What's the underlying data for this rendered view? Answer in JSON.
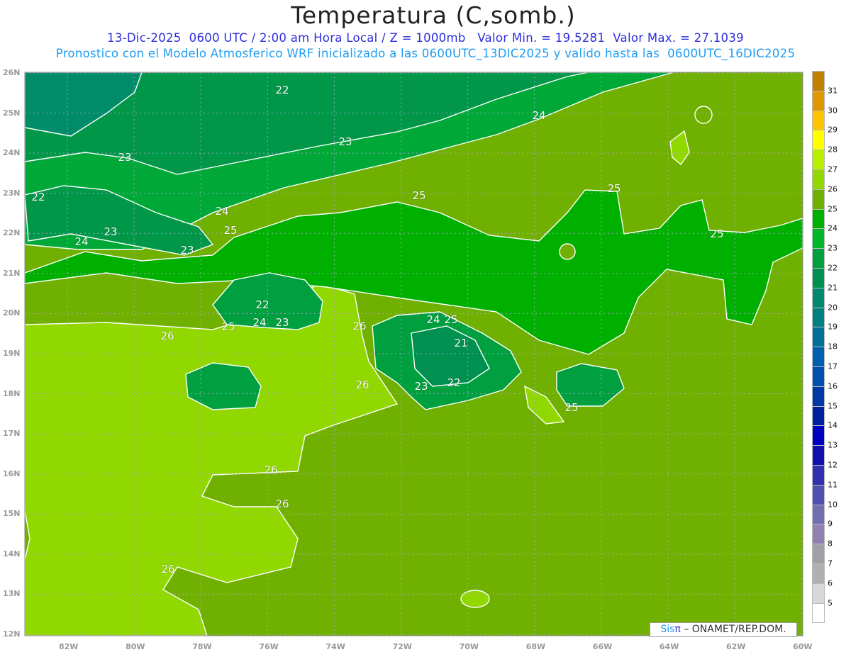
{
  "header": {
    "title": "Temperatura (C,somb.)",
    "subtitle1": "13-Dic-2025  0600 UTC / 2:00 am Hora Local / Z = 1000mb   Valor Min. = 19.5281  Valor Max. = 27.1039",
    "subtitle2": "Pronostico con el Modelo Atmosferico WRF inicializado a las 0600UTC_13DIC2025 y valido hasta las  0600UTC_16DIC2025"
  },
  "map": {
    "lon_ticks": [
      "82W",
      "80W",
      "78W",
      "76W",
      "74W",
      "72W",
      "70W",
      "68W",
      "66W",
      "64W",
      "62W",
      "60W"
    ],
    "lat_ticks": [
      "26N",
      "25N",
      "24N",
      "23N",
      "22N",
      "21N",
      "20N",
      "19N",
      "18N",
      "17N",
      "16N",
      "15N",
      "14N",
      "13N",
      "12N"
    ],
    "contour_labels": [
      "22",
      "24",
      "23",
      "23",
      "25",
      "22",
      "25",
      "24",
      "25",
      "23",
      "25",
      "24",
      "23",
      "22",
      "24",
      "23",
      "25",
      "24",
      "25",
      "26",
      "21",
      "26",
      "26",
      "23",
      "22",
      "25",
      "26",
      "26",
      "26"
    ],
    "colors": {
      "t26_27": "#90d800",
      "t25_26": "#70b000",
      "t24_25": "#00b000",
      "t23_24": "#00a838",
      "t22_23": "#009848",
      "t21_22": "#008c68",
      "t20_21": "#008878"
    }
  },
  "colorbar": {
    "labels": [
      "31",
      "30",
      "29",
      "28",
      "27",
      "26",
      "25",
      "24",
      "23",
      "22",
      "21",
      "20",
      "19",
      "18",
      "17",
      "16",
      "15",
      "14",
      "13",
      "12",
      "11",
      "10",
      "9",
      "8",
      "7",
      "6",
      "5"
    ],
    "colors": [
      "#c08000",
      "#e09800",
      "#ffc400",
      "#ffff00",
      "#b8f000",
      "#90d800",
      "#70b000",
      "#00b000",
      "#00b828",
      "#00a040",
      "#009050",
      "#008870",
      "#008080",
      "#007098",
      "#0060b0",
      "#0050b0",
      "#0038a8",
      "#0020a0",
      "#0000c0",
      "#1010b0",
      "#3030b0",
      "#5050b0",
      "#7070b0",
      "#9080b0",
      "#a0a0a8",
      "#b0b0b0",
      "#d8d8d8",
      "#ffffff"
    ]
  },
  "footer": {
    "logo_sis": "Sis",
    "logo_pi": "π",
    "logo_text": " – ONAMET/REP.DOM."
  }
}
